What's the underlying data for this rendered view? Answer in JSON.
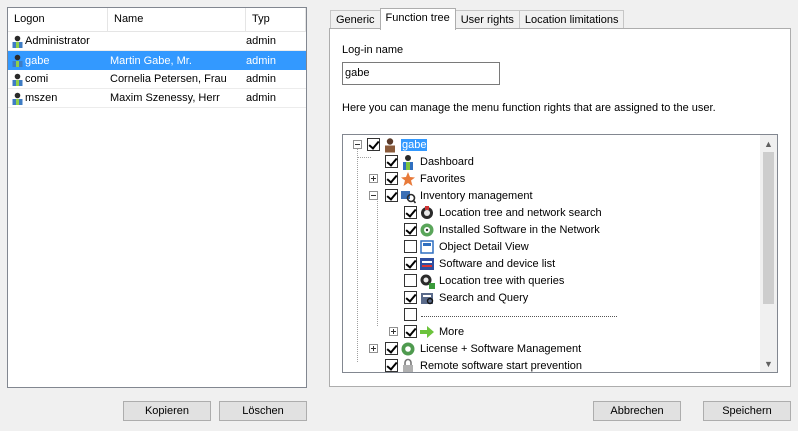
{
  "users_list": {
    "columns": {
      "logon": "Logon",
      "name": "Name",
      "typ": "Typ"
    },
    "rows": [
      {
        "logon": "Administrator",
        "name": "",
        "typ": "admin",
        "selected": false
      },
      {
        "logon": "gabe",
        "name": "Martin Gabe, Mr.",
        "typ": "admin",
        "selected": true
      },
      {
        "logon": "comi",
        "name": "Cornelia Petersen, Frau",
        "typ": "admin",
        "selected": false
      },
      {
        "logon": "mszen",
        "name": "Maxim Szenessy, Herr",
        "typ": "admin",
        "selected": false
      }
    ]
  },
  "tabs": [
    {
      "label": "Generic",
      "active": false
    },
    {
      "label": "Function tree",
      "active": true
    },
    {
      "label": "User rights",
      "active": false
    },
    {
      "label": "Location limitations",
      "active": false
    }
  ],
  "form": {
    "login_label": "Log-in name",
    "login_value": "gabe",
    "description": "Here you can manage the menu function rights that are assigned to the user."
  },
  "tree": [
    {
      "label": "gabe",
      "checked": true,
      "icon": "user-icon",
      "selected": true
    },
    {
      "label": "Dashboard",
      "checked": true,
      "icon": "dashboard-icon"
    },
    {
      "label": "Favorites",
      "checked": true,
      "icon": "favorites-star-icon"
    },
    {
      "label": "Inventory management",
      "checked": true,
      "icon": "inventory-icon"
    },
    {
      "label": "Location tree and network search",
      "checked": true,
      "icon": "network-search-icon"
    },
    {
      "label": "Installed Software in the Network",
      "checked": true,
      "icon": "software-disc-icon"
    },
    {
      "label": "Object Detail View",
      "checked": false,
      "icon": "detail-view-icon"
    },
    {
      "label": "Software and device list",
      "checked": true,
      "icon": "device-list-icon"
    },
    {
      "label": "Location tree with queries",
      "checked": false,
      "icon": "query-tree-icon"
    },
    {
      "label": "Search and Query",
      "checked": true,
      "icon": "search-query-icon"
    },
    {
      "label": "",
      "checked": false,
      "icon": "separator"
    },
    {
      "label": "More",
      "checked": true,
      "icon": "arrow-right-icon"
    },
    {
      "label": "License + Software Management",
      "checked": true,
      "icon": "license-icon"
    },
    {
      "label": "Remote software start prevention",
      "checked": true,
      "icon": "lock-icon"
    }
  ],
  "buttons": {
    "copy": "Kopieren",
    "delete": "Löschen",
    "cancel": "Abbrechen",
    "save": "Speichern"
  }
}
